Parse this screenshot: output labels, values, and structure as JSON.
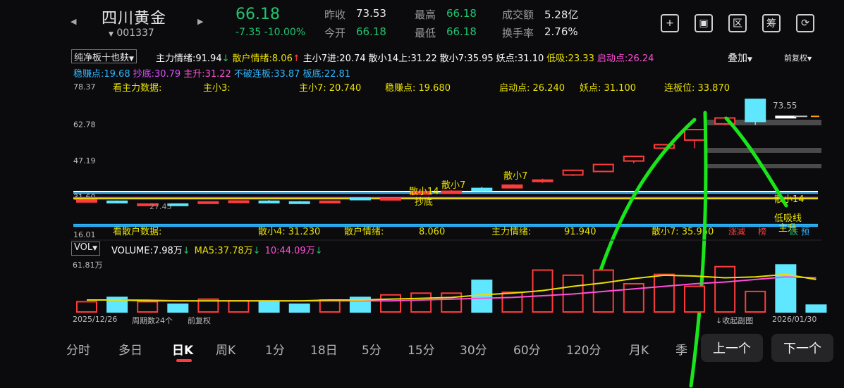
{
  "header": {
    "name": "四川黄金",
    "code": "001337",
    "price": "66.18",
    "change": "-7.35",
    "change_pct": "-10.00%",
    "quotes": [
      {
        "label": "昨收",
        "value": "73.53",
        "color": "white"
      },
      {
        "label": "最高",
        "value": "66.18",
        "color": "green"
      },
      {
        "label": "成交额",
        "value": "5.28亿",
        "color": "white"
      },
      {
        "label": "今开",
        "value": "66.18",
        "color": "green"
      },
      {
        "label": "最低",
        "value": "66.18",
        "color": "green"
      },
      {
        "label": "换手率",
        "value": "2.76%",
        "color": "white"
      }
    ],
    "tools": [
      {
        "name": "add-icon",
        "glyph": "+"
      },
      {
        "name": "screen-icon",
        "glyph": "▣"
      },
      {
        "name": "range-select-icon",
        "glyph": "区"
      },
      {
        "name": "chip-icon",
        "glyph": "筹"
      },
      {
        "name": "landscape-rotate-icon",
        "glyph": "⟳"
      }
    ]
  },
  "indicator": {
    "selector": "纯净板十也麸",
    "row1": [
      {
        "text": "主力情绪:91.94",
        "color": "#ffffff",
        "arrow": "↓",
        "arrow_color": "#22c36e"
      },
      {
        "text": "散户情绪:8.06",
        "color": "#e8e000",
        "arrow": "↑",
        "arrow_color": "#ff3b3b"
      },
      {
        "text": "主小7进:20.74",
        "color": "#ffffff"
      },
      {
        "text": "散小14上:31.22",
        "color": "#ffffff"
      },
      {
        "text": "散小7:35.95",
        "color": "#ffffff"
      },
      {
        "text": "妖点:31.10",
        "color": "#ffffff"
      },
      {
        "text": "低吸:23.33",
        "color": "#e8e000"
      },
      {
        "text": "启动点:26.24",
        "color": "#ff4fd8"
      }
    ],
    "row2": [
      {
        "text": "稳赚点:19.68",
        "color": "#2fb7ff"
      },
      {
        "text": "抄底:30.79",
        "color": "#d94cff"
      },
      {
        "text": "主升:31.22",
        "color": "#ff4fd8"
      },
      {
        "text": "不破连板:33.87",
        "color": "#2fb7ff"
      },
      {
        "text": "板底:22.81",
        "color": "#2fb7ff"
      }
    ],
    "overlay": "叠加",
    "adjust": "前复权"
  },
  "main_chart": {
    "y_labels": [
      "78.37",
      "62.78",
      "47.19",
      "31.60",
      "16.01"
    ],
    "top_text": [
      {
        "text": "看主力数据:",
        "color": "#e8e000"
      },
      {
        "text": "主小3:",
        "color": "#e8e000"
      },
      {
        "text": "主小7:  20.740",
        "color": "#e8e000"
      },
      {
        "text": "稳赚点:  19.680",
        "color": "#e8e000"
      },
      {
        "text": "启动点:  26.240",
        "color": "#e8e000"
      },
      {
        "text": "妖点:    31.100",
        "color": "#e8e000"
      },
      {
        "text": "连板位:  33.870",
        "color": "#e8e000"
      }
    ],
    "bottom_text": [
      {
        "text": "看散户数据:",
        "color": "#e8e000"
      },
      {
        "text": "散小4:  31.230",
        "color": "#e8e000"
      },
      {
        "text": "散户情绪:",
        "color": "#e8e000"
      },
      {
        "text": "8.060",
        "color": "#e8e000"
      },
      {
        "text": "主力情绪:",
        "color": "#e8e000"
      },
      {
        "text": "91.940",
        "color": "#e8e000"
      },
      {
        "text": "散小7:  35.950",
        "color": "#e8e000"
      }
    ],
    "last_price_label": "73.55",
    "low_price_label": "27.45",
    "annotations": [
      {
        "text": "散小7",
        "color": "#e8e000"
      },
      {
        "text": "散小7",
        "color": "#e8e000"
      },
      {
        "text": "散小14",
        "color": "#e8e000"
      },
      {
        "text": "抄底",
        "color": "#e8e000"
      },
      {
        "text": "散小14",
        "color": "#e8e000"
      },
      {
        "text": "低吸线",
        "color": "#e8e000"
      },
      {
        "text": "主升",
        "color": "#e8e000"
      }
    ],
    "tags": [
      {
        "text": "涨减",
        "color": "#ff3b3b"
      },
      {
        "text": "榜",
        "color": "#ff3b3b"
      },
      {
        "text": "跌",
        "color": "#22c36e"
      },
      {
        "text": "预",
        "color": "#2fb7ff"
      }
    ],
    "candles": [
      {
        "o": 30.2,
        "c": 29.4,
        "h": 30.4,
        "l": 29.2,
        "color": "red"
      },
      {
        "o": 29.5,
        "c": 29.7,
        "h": 30.0,
        "l": 29.0,
        "color": "cyan"
      },
      {
        "o": 28.5,
        "c": 28.1,
        "h": 28.7,
        "l": 27.9,
        "color": "red"
      },
      {
        "o": 28.3,
        "c": 28.5,
        "h": 28.7,
        "l": 27.6,
        "color": "cyan"
      },
      {
        "o": 29.4,
        "c": 28.8,
        "h": 29.6,
        "l": 28.7,
        "color": "red"
      },
      {
        "o": 29.8,
        "c": 29.2,
        "h": 30.0,
        "l": 29.1,
        "color": "red"
      },
      {
        "o": 29.5,
        "c": 29.7,
        "h": 30.2,
        "l": 29.2,
        "color": "cyan"
      },
      {
        "o": 29.2,
        "c": 29.4,
        "h": 29.8,
        "l": 29.0,
        "color": "cyan"
      },
      {
        "o": 29.7,
        "c": 29.2,
        "h": 30.0,
        "l": 29.1,
        "color": "red"
      },
      {
        "o": 30.6,
        "c": 31.0,
        "h": 31.3,
        "l": 30.3,
        "color": "cyan"
      },
      {
        "o": 30.4,
        "c": 30.9,
        "h": 31.1,
        "l": 30.3,
        "color": "red"
      },
      {
        "o": 32.8,
        "c": 33.9,
        "h": 34.3,
        "l": 32.6,
        "color": "red"
      },
      {
        "o": 33.1,
        "c": 34.0,
        "h": 34.5,
        "l": 32.9,
        "color": "red"
      },
      {
        "o": 34.3,
        "c": 35.2,
        "h": 35.8,
        "l": 33.7,
        "color": "cyan"
      },
      {
        "o": 35.5,
        "c": 36.6,
        "h": 37.0,
        "l": 35.3,
        "color": "red"
      },
      {
        "o": 38.3,
        "c": 38.8,
        "h": 39.4,
        "l": 37.6,
        "color": "red"
      },
      {
        "o": 41.0,
        "c": 43.0,
        "h": 43.2,
        "l": 40.5,
        "color": "red"
      },
      {
        "o": 42.5,
        "c": 45.5,
        "h": 45.7,
        "l": 42.2,
        "color": "red"
      },
      {
        "o": 47.0,
        "c": 49.0,
        "h": 49.3,
        "l": 46.0,
        "color": "red"
      },
      {
        "o": 52.5,
        "c": 54.0,
        "h": 54.3,
        "l": 51.8,
        "color": "red"
      },
      {
        "o": 56.0,
        "c": 60.5,
        "h": 60.8,
        "l": 52.5,
        "color": "red"
      },
      {
        "o": 63.0,
        "c": 65.5,
        "h": 66.0,
        "l": 62.5,
        "color": "red"
      },
      {
        "o": 73.5,
        "c": 64.0,
        "h": 73.5,
        "l": 62.5,
        "color": "cyan"
      },
      {
        "o": 66.18,
        "c": 66.18,
        "h": 66.18,
        "l": 66.18,
        "color": "white"
      }
    ],
    "hlines": [
      {
        "y": 33.87,
        "color": "#ffffff"
      },
      {
        "y": 33.2,
        "color": "#2fb7ff"
      },
      {
        "y": 31.22,
        "color": "#d94cff"
      },
      {
        "y": 30.79,
        "color": "#e8e000"
      },
      {
        "y": 19.68,
        "color": "#2fb7ff"
      },
      {
        "y": 19.0,
        "color": "#2fb7ff"
      }
    ],
    "ymin": 16.01,
    "ymax": 78.37
  },
  "volume": {
    "selector": "VOL",
    "legend": [
      {
        "text": "VOLUME:7.98万",
        "color": "#ffffff",
        "arrow": "↓",
        "arrow_color": "#22c36e"
      },
      {
        "text": "MA5:37.78万",
        "color": "#e8e000",
        "arrow": "↓",
        "arrow_color": "#22c36e"
      },
      {
        "text": "10:44.09万",
        "color": "#ff4fd8",
        "arrow": "↓",
        "arrow_color": "#22c36e"
      }
    ],
    "y_label": "61.81万",
    "bars": [
      12,
      17,
      12,
      9,
      15,
      13,
      12,
      9,
      14,
      17,
      20,
      22,
      22,
      37,
      23,
      49,
      43,
      49,
      33,
      44,
      30,
      53,
      24,
      55,
      8
    ],
    "bar_colors": [
      "red",
      "cyan",
      "red",
      "cyan",
      "red",
      "red",
      "cyan",
      "cyan",
      "red",
      "cyan",
      "red",
      "red",
      "red",
      "cyan",
      "red",
      "red",
      "red",
      "red",
      "red",
      "red",
      "red",
      "red",
      "red",
      "cyan",
      "cyan"
    ],
    "ma5": [
      14,
      14,
      13,
      13,
      13,
      13,
      13,
      13,
      14,
      14,
      15,
      16,
      17,
      20,
      22,
      25,
      30,
      34,
      39,
      43,
      42,
      40,
      41,
      44,
      38
    ],
    "ma10": [
      14,
      14,
      14,
      13,
      13,
      13,
      13,
      13,
      13,
      13,
      13,
      14,
      15,
      16,
      17,
      19,
      21,
      24,
      27,
      30,
      33,
      35,
      38,
      41,
      40
    ],
    "max": 61.81,
    "date_start": "2025/12/26",
    "period_count": "周期数24个",
    "adjust": "前复权",
    "collapse": "收起副图",
    "date_end": "2026/01/30"
  },
  "periods": [
    "分时",
    "多日",
    "日K",
    "周K",
    "1分",
    "18日",
    "5分",
    "15分",
    "30分",
    "60分",
    "120分",
    "月K",
    "季"
  ],
  "active_period": "日K",
  "nav": {
    "prev": "上一个",
    "next": "下一个"
  },
  "colors": {
    "red": "#ff3b3b",
    "green": "#22c36e",
    "cyan": "#5ee7ff",
    "yellow": "#e8e000",
    "magenta": "#ff4fd8"
  }
}
